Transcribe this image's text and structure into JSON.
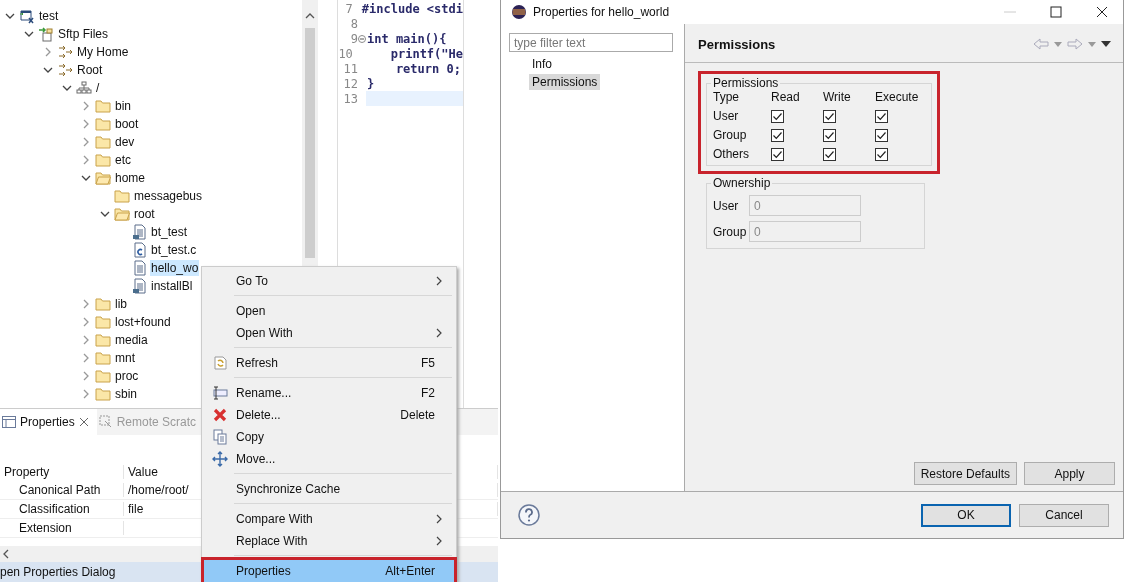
{
  "tree": [
    {
      "label": "test",
      "kind": "project",
      "expanded": true,
      "selected": false,
      "children": [
        {
          "label": "Sftp Files",
          "kind": "connection-group",
          "expanded": true,
          "selected": false,
          "children": [
            {
              "label": "My Home",
              "kind": "connection",
              "expanded": false,
              "selected": false
            },
            {
              "label": "Root",
              "kind": "connection",
              "expanded": true,
              "selected": false,
              "children": [
                {
                  "label": "/",
                  "kind": "filesystem",
                  "expanded": true,
                  "selected": false,
                  "children": [
                    {
                      "label": "bin",
                      "kind": "folder",
                      "expanded": false,
                      "selected": false
                    },
                    {
                      "label": "boot",
                      "kind": "folder",
                      "expanded": false,
                      "selected": false
                    },
                    {
                      "label": "dev",
                      "kind": "folder",
                      "expanded": false,
                      "selected": false
                    },
                    {
                      "label": "etc",
                      "kind": "folder",
                      "expanded": false,
                      "selected": false
                    },
                    {
                      "label": "home",
                      "kind": "folder",
                      "expanded": true,
                      "selected": false,
                      "children": [
                        {
                          "label": "messagebus",
                          "kind": "folder",
                          "selected": false
                        },
                        {
                          "label": "root",
                          "kind": "folder",
                          "expanded": true,
                          "selected": false,
                          "children": [
                            {
                              "label": "bt_test",
                              "kind": "binary",
                              "selected": false
                            },
                            {
                              "label": "bt_test.c",
                              "kind": "c-file",
                              "selected": false
                            },
                            {
                              "label": "hello_wo",
                              "kind": "file",
                              "selected": true
                            },
                            {
                              "label": "installBl",
                              "kind": "binary",
                              "selected": false
                            }
                          ]
                        }
                      ]
                    },
                    {
                      "label": "lib",
                      "kind": "folder",
                      "expanded": false,
                      "selected": false
                    },
                    {
                      "label": "lost+found",
                      "kind": "folder",
                      "expanded": false,
                      "selected": false
                    },
                    {
                      "label": "media",
                      "kind": "folder",
                      "expanded": false,
                      "selected": false
                    },
                    {
                      "label": "mnt",
                      "kind": "folder",
                      "expanded": false,
                      "selected": false
                    },
                    {
                      "label": "proc",
                      "kind": "folder",
                      "expanded": false,
                      "selected": false
                    },
                    {
                      "label": "sbin",
                      "kind": "folder",
                      "expanded": false,
                      "selected": false
                    }
                  ]
                }
              ]
            }
          ]
        }
      ]
    }
  ],
  "editor": {
    "lines": [
      {
        "number": "7",
        "text": "#include <stdi"
      },
      {
        "number": "8"
      },
      {
        "number": "9",
        "text": "int main(){",
        "folded": false
      },
      {
        "number": "10",
        "text": "    printf(\"He"
      },
      {
        "number": "11",
        "text": "    return 0;"
      },
      {
        "number": "12",
        "text": "}"
      },
      {
        "number": "13",
        "current": true
      }
    ]
  },
  "properties_view": {
    "tabs": [
      {
        "label": "Properties",
        "selected": true
      },
      {
        "label": "Remote Scratc",
        "selected": false
      }
    ],
    "columns": [
      "Property",
      "Value"
    ],
    "rows": [
      {
        "property": "Canonical Path",
        "value": "/home/root/"
      },
      {
        "property": "Classification",
        "value": "file"
      },
      {
        "property": "Extension"
      }
    ]
  },
  "status_bar": "pen Properties Dialog",
  "context_menu": [
    {
      "kind": "submenu",
      "label": "Go To",
      "selected": false,
      "highlighted": false
    },
    {
      "kind": "separator"
    },
    {
      "kind": "plain",
      "label": "Open",
      "selected": false,
      "highlighted": false
    },
    {
      "kind": "submenu",
      "label": "Open With",
      "selected": false,
      "highlighted": false
    },
    {
      "kind": "separator"
    },
    {
      "kind": "refresh",
      "label": "Refresh",
      "shortcut": "F5",
      "selected": false,
      "highlighted": false
    },
    {
      "kind": "separator"
    },
    {
      "kind": "rename",
      "label": "Rename...",
      "shortcut": "F2",
      "selected": false,
      "highlighted": false
    },
    {
      "kind": "delete",
      "label": "Delete...",
      "shortcut": "Delete",
      "selected": false,
      "highlighted": false
    },
    {
      "kind": "copy",
      "label": "Copy",
      "selected": false,
      "highlighted": false
    },
    {
      "kind": "move",
      "label": "Move...",
      "selected": false,
      "highlighted": false
    },
    {
      "kind": "separator"
    },
    {
      "kind": "plain",
      "label": "Synchronize Cache",
      "selected": false,
      "highlighted": false
    },
    {
      "kind": "separator"
    },
    {
      "kind": "submenu",
      "label": "Compare With",
      "selected": false,
      "highlighted": false
    },
    {
      "kind": "submenu",
      "label": "Replace With",
      "selected": false,
      "highlighted": false
    },
    {
      "kind": "separator"
    },
    {
      "kind": "plain",
      "label": "Properties",
      "shortcut": "Alt+Enter",
      "selected": true,
      "highlighted": true
    }
  ],
  "dialog": {
    "title": "Properties for hello_world",
    "filter": {
      "placeholder": "type filter text"
    },
    "nav": [
      {
        "label": "Info",
        "selected": false
      },
      {
        "label": "Permissions",
        "selected": true
      }
    ],
    "page_title": "Permissions",
    "permissions": {
      "legend": "Permissions",
      "highlighted": true,
      "headers": [
        "Type",
        "Read",
        "Write",
        "Execute"
      ],
      "rows": [
        {
          "type": "User",
          "read": true,
          "write": true,
          "execute": true
        },
        {
          "type": "Group",
          "read": true,
          "write": true,
          "execute": true
        },
        {
          "type": "Others",
          "read": true,
          "write": true,
          "execute": true
        }
      ]
    },
    "ownership": {
      "legend": "Ownership",
      "fields": [
        {
          "label": "User",
          "value": "0",
          "disabled": true
        },
        {
          "label": "Group",
          "value": "0",
          "disabled": true
        }
      ]
    },
    "page_buttons": [
      "Restore Defaults",
      "Apply"
    ],
    "buttons": [
      {
        "label": "OK",
        "default": true
      },
      {
        "label": "Cancel",
        "default": false
      }
    ]
  }
}
